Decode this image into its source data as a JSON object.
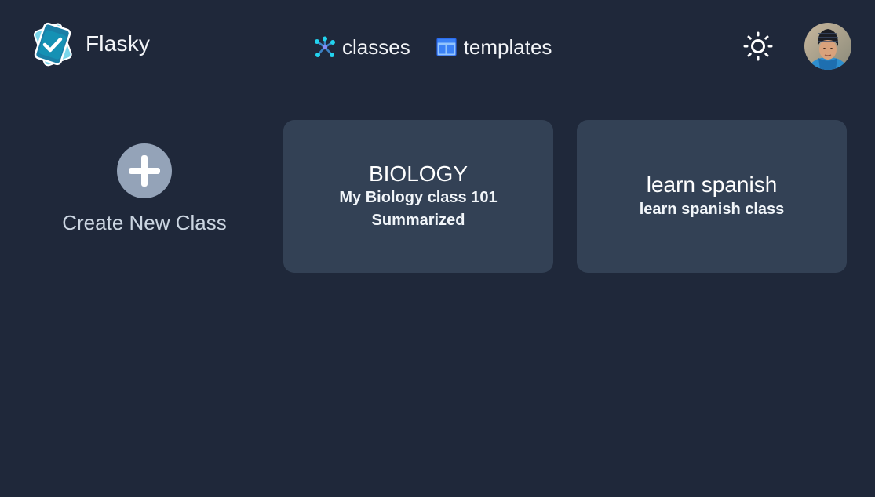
{
  "app": {
    "name": "Flasky"
  },
  "nav": {
    "classes_label": "classes",
    "templates_label": "templates"
  },
  "header": {
    "theme_icon": "sun-icon",
    "avatar_icon": "user-avatar"
  },
  "create_class": {
    "label": "Create New Class",
    "icon": "plus-circle-icon"
  },
  "classes": [
    {
      "title": "BIOLOGY",
      "description": "My Biology class 101",
      "subtitle": "Summarized"
    },
    {
      "title": "learn spanish",
      "description": "learn spanish class"
    }
  ],
  "colors": {
    "background": "#1f283a",
    "card": "#334155",
    "plus_circle": "#94a3b8",
    "logo_teal": "#1591b4",
    "templates_icon": "#60a5fa"
  }
}
